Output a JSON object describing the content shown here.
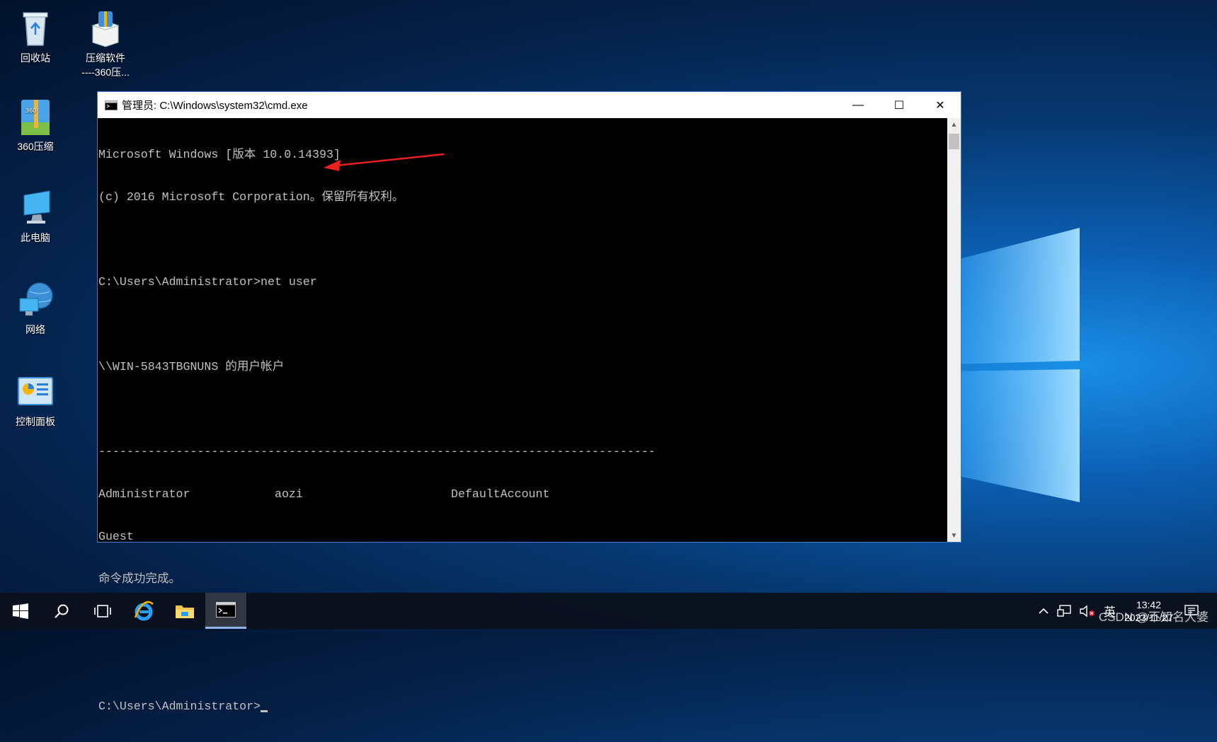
{
  "desktop": {
    "icons": [
      {
        "label": "回收站",
        "icon": "recycle-bin-icon"
      },
      {
        "label": "压缩软件\n----360压...",
        "icon": "installer-box-icon"
      },
      {
        "label": "360压缩",
        "icon": "zip-archive-icon"
      },
      {
        "label": "此电脑",
        "icon": "computer-icon"
      },
      {
        "label": "网络",
        "icon": "network-globe-icon"
      },
      {
        "label": "控制面板",
        "icon": "control-panel-icon"
      }
    ]
  },
  "window": {
    "title": "管理员: C:\\Windows\\system32\\cmd.exe",
    "minimize": "—",
    "maximize": "☐",
    "close": "✕"
  },
  "console": {
    "line1": "Microsoft Windows [版本 10.0.14393]",
    "line2": "(c) 2016 Microsoft Corporation。保留所有权利。",
    "prompt1": "C:\\Users\\Administrator>",
    "command": "net user",
    "accounts_header": "\\\\WIN-5843TBGNUNS 的用户帐户",
    "separator": "-------------------------------------------------------------------------------",
    "users": [
      "Administrator",
      "aozi",
      "DefaultAccount",
      "Guest"
    ],
    "result": "命令成功完成。",
    "prompt2": "C:\\Users\\Administrator>"
  },
  "annotation": {
    "color": "#e8211f"
  },
  "taskbar": {
    "items": [
      "windows-start-icon",
      "search-icon",
      "task-view-icon",
      "internet-explorer-icon",
      "file-explorer-icon",
      "cmd-icon"
    ],
    "tray_ime": "英",
    "time": "13:42",
    "date": "2023/11/27"
  },
  "watermark": "CSDN @不知名大婆"
}
